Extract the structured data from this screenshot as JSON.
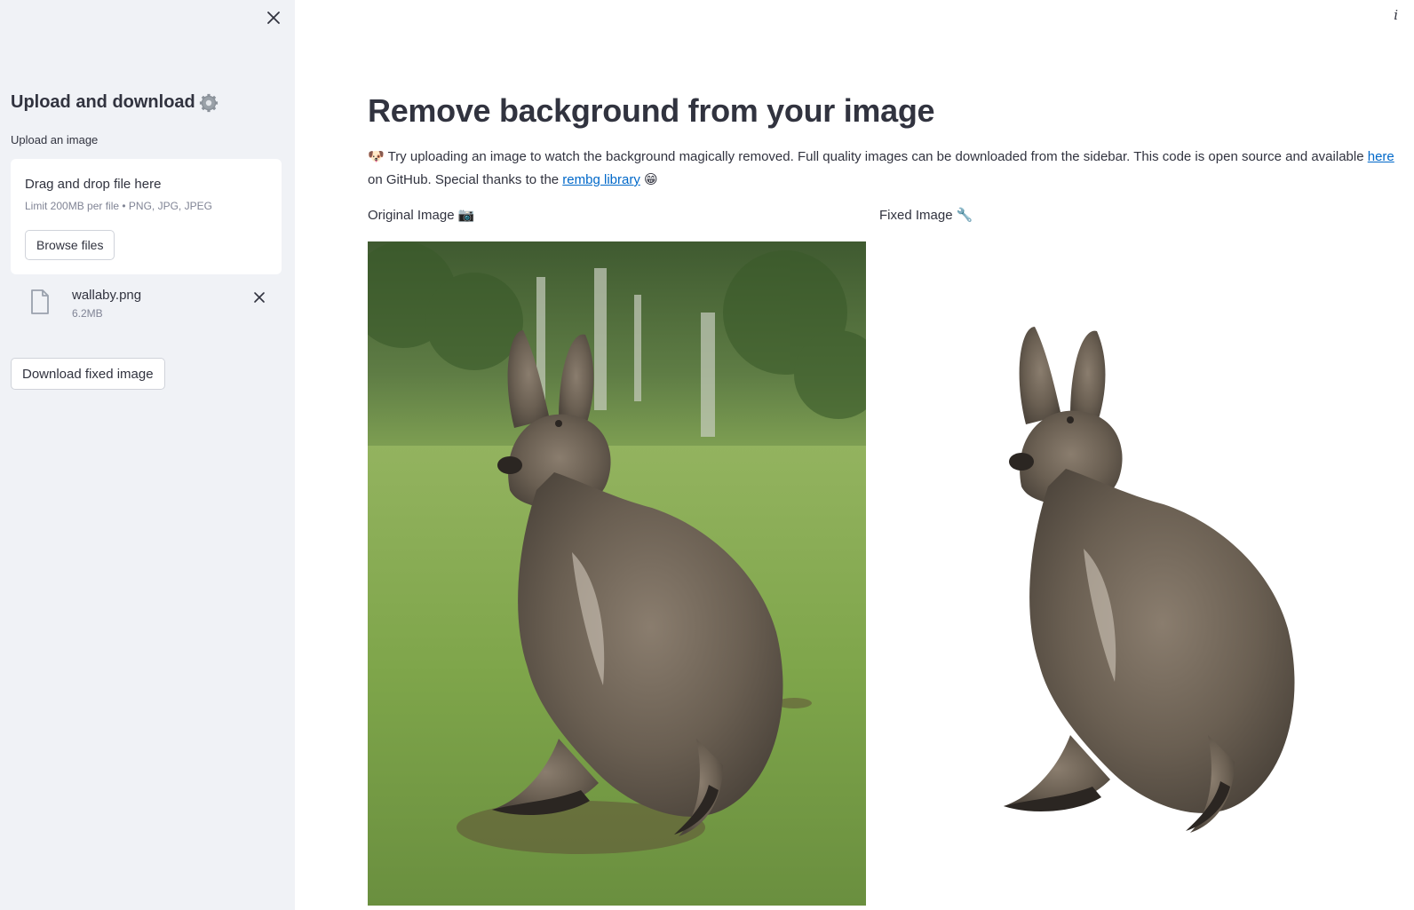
{
  "sidebar": {
    "title": "Upload and download",
    "upload_label": "Upload an image",
    "dropzone": {
      "title": "Drag and drop file here",
      "limit": "Limit 200MB per file • PNG, JPG, JPEG",
      "browse_label": "Browse files"
    },
    "file": {
      "name": "wallaby.png",
      "size": "6.2MB"
    },
    "download_label": "Download fixed image"
  },
  "main": {
    "info": "i",
    "title": "Remove background from your image",
    "intro": {
      "emoji": "🐶",
      "text1": " Try uploading an image to watch the background magically removed. Full quality images can be downloaded from the sidebar. This code is open source and available ",
      "link1": "here",
      "text2": " on GitHub. Special thanks to the ",
      "link2": "rembg library",
      "emoji2": "😁"
    },
    "original_label": "Original Image",
    "original_emoji": "📷",
    "fixed_label": "Fixed Image",
    "fixed_emoji": "🔧"
  },
  "colors": {
    "sidebar_bg": "#f0f2f6",
    "link": "#0068c9",
    "text": "#31333f",
    "muted": "#808495"
  }
}
